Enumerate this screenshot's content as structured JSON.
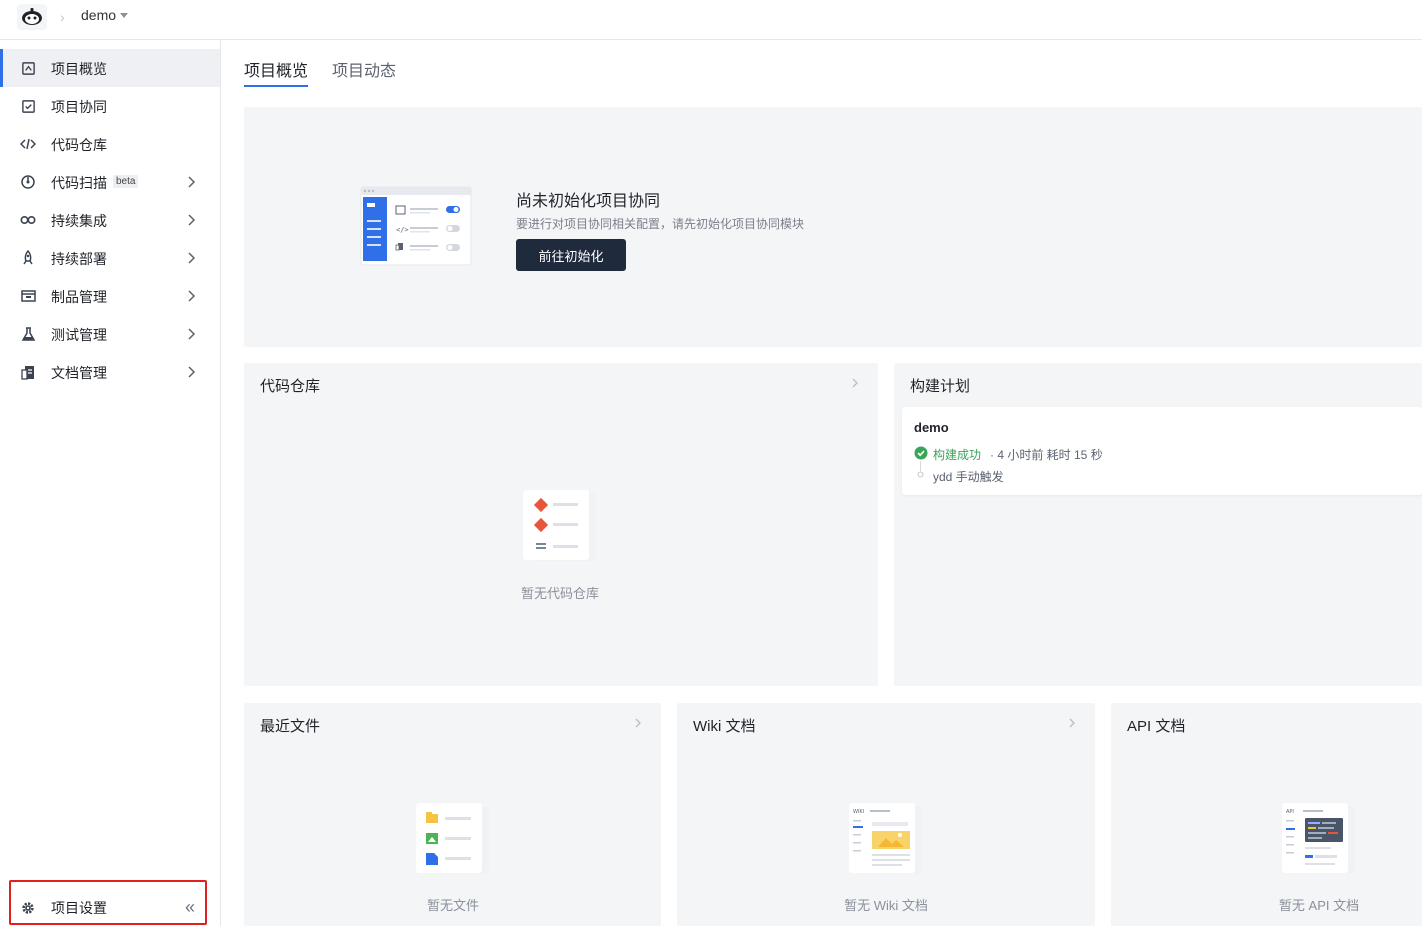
{
  "topbar": {
    "project_name": "demo"
  },
  "sidebar": {
    "items": [
      {
        "label": "项目概览",
        "icon": "home-icon",
        "active": true,
        "has_children": false
      },
      {
        "label": "项目协同",
        "icon": "checkbox-icon",
        "active": false,
        "has_children": false
      },
      {
        "label": "代码仓库",
        "icon": "code-icon",
        "active": false,
        "has_children": false
      },
      {
        "label": "代码扫描",
        "icon": "scan-icon",
        "active": false,
        "has_children": true,
        "badge": "beta"
      },
      {
        "label": "持续集成",
        "icon": "infinity-icon",
        "active": false,
        "has_children": true
      },
      {
        "label": "持续部署",
        "icon": "rocket-icon",
        "active": false,
        "has_children": true
      },
      {
        "label": "制品管理",
        "icon": "box-icon",
        "active": false,
        "has_children": true
      },
      {
        "label": "测试管理",
        "icon": "flask-icon",
        "active": false,
        "has_children": true
      },
      {
        "label": "文档管理",
        "icon": "document-icon",
        "active": false,
        "has_children": true
      }
    ],
    "settings_label": "项目设置",
    "collapse_glyph": "«"
  },
  "tabs": [
    {
      "label": "项目概览",
      "active": true
    },
    {
      "label": "项目动态",
      "active": false
    }
  ],
  "init_banner": {
    "title": "尚未初始化项目协同",
    "description": "要进行对项目协同相关配置，请先初始化项目协同模块",
    "button_label": "前往初始化"
  },
  "panels": {
    "code_repo": {
      "title": "代码仓库",
      "empty_text": "暂无代码仓库"
    },
    "build_plan": {
      "title": "构建计划",
      "card": {
        "name": "demo",
        "status": "构建成功",
        "meta": "· 4 小时前  耗时 15 秒",
        "trigger": "ydd 手动触发"
      }
    },
    "recent_files": {
      "title": "最近文件",
      "empty_text": "暂无文件"
    },
    "wiki": {
      "title": "Wiki 文档",
      "empty_text": "暂无 Wiki 文档"
    },
    "api": {
      "title": "API 文档",
      "empty_text": "暂无 API 文档"
    }
  },
  "colors": {
    "accent": "#2f6fe8",
    "success": "#3aa45b",
    "button_dark": "#1f2a3c",
    "panel_bg": "#f4f5f7",
    "highlight_border": "#e0201f"
  }
}
